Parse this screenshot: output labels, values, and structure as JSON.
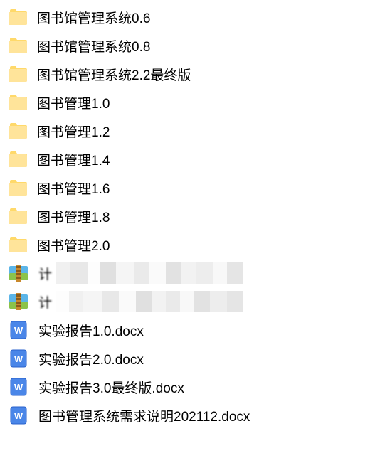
{
  "items": [
    {
      "type": "folder",
      "name": "图书馆管理系统0.6"
    },
    {
      "type": "folder",
      "name": "图书馆管理系统0.8"
    },
    {
      "type": "folder",
      "name": "图书馆管理系统2.2最终版"
    },
    {
      "type": "folder",
      "name": "图书管理1.0"
    },
    {
      "type": "folder",
      "name": "图书管理1.2"
    },
    {
      "type": "folder",
      "name": "图书管理1.4"
    },
    {
      "type": "folder",
      "name": "图书管理1.6"
    },
    {
      "type": "folder",
      "name": "图书管理1.8"
    },
    {
      "type": "folder",
      "name": "图书管理2.0"
    },
    {
      "type": "archive",
      "name": "计",
      "blurred": true
    },
    {
      "type": "archive",
      "name": "计",
      "blurred": true
    },
    {
      "type": "docx",
      "name": "实验报告1.0.docx"
    },
    {
      "type": "docx",
      "name": "实验报告2.0.docx"
    },
    {
      "type": "docx",
      "name": "实验报告3.0最终版.docx"
    },
    {
      "type": "docx",
      "name": "图书管理系统需求说明202112.docx"
    }
  ]
}
